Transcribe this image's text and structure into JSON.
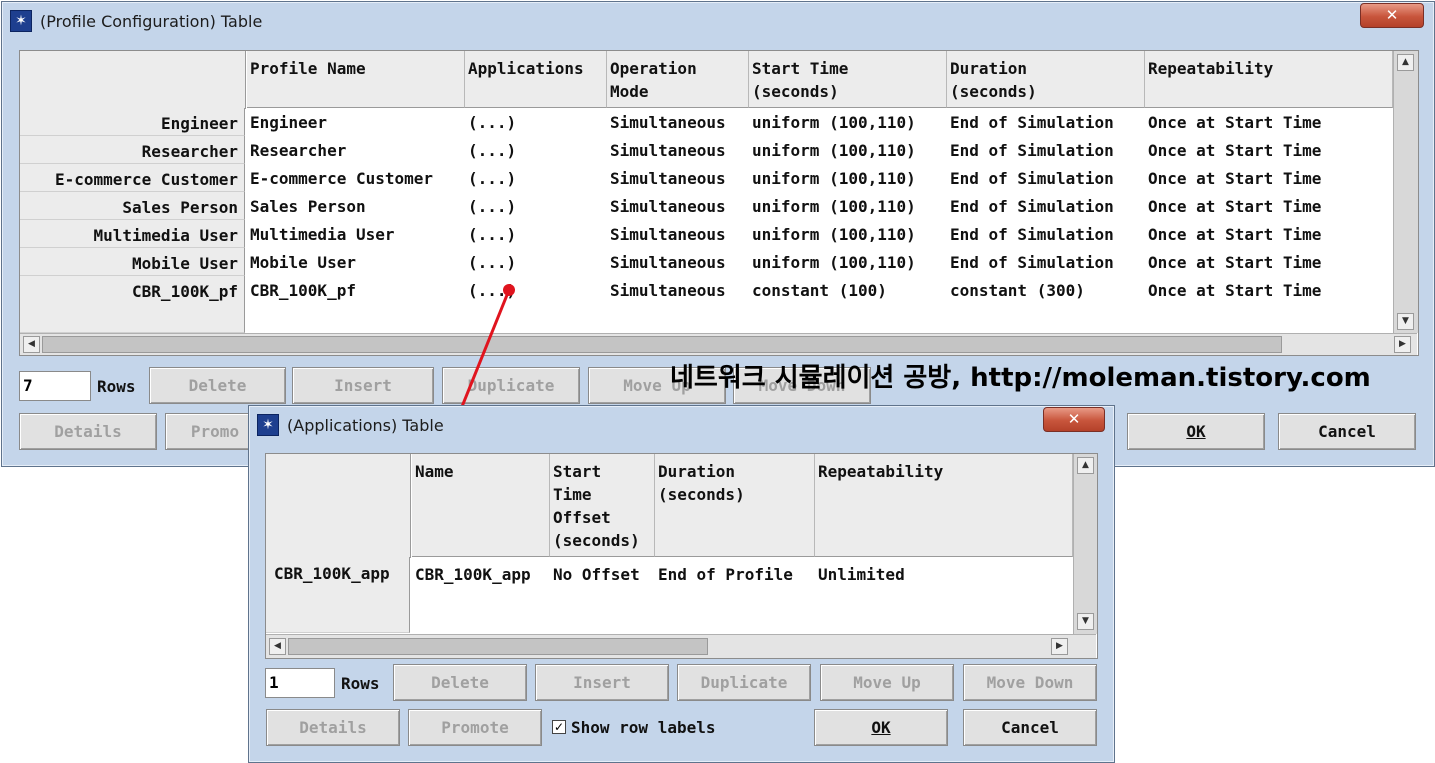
{
  "watermark": "네트워크 시뮬레이션 공방, http://moleman.tistory.com",
  "profile_window": {
    "title": "(Profile Configuration) Table",
    "close_symbol": "✕",
    "columns": [
      "Profile Name",
      "Applications",
      "Operation\nMode",
      "Start Time\n(seconds)",
      "Duration\n(seconds)",
      "Repeatability"
    ],
    "rows": [
      {
        "label": "Engineer",
        "cells": [
          "Engineer",
          "(...)",
          "Simultaneous",
          "uniform (100,110)",
          "End of Simulation",
          "Once at Start Time"
        ]
      },
      {
        "label": "Researcher",
        "cells": [
          "Researcher",
          "(...)",
          "Simultaneous",
          "uniform (100,110)",
          "End of Simulation",
          "Once at Start Time"
        ]
      },
      {
        "label": "E-commerce Customer",
        "cells": [
          "E-commerce Customer",
          "(...)",
          "Simultaneous",
          "uniform (100,110)",
          "End of Simulation",
          "Once at Start Time"
        ]
      },
      {
        "label": "Sales Person",
        "cells": [
          "Sales Person",
          "(...)",
          "Simultaneous",
          "uniform (100,110)",
          "End of Simulation",
          "Once at Start Time"
        ]
      },
      {
        "label": "Multimedia User",
        "cells": [
          "Multimedia User",
          "(...)",
          "Simultaneous",
          "uniform (100,110)",
          "End of Simulation",
          "Once at Start Time"
        ]
      },
      {
        "label": "Mobile User",
        "cells": [
          "Mobile User",
          "(...)",
          "Simultaneous",
          "uniform (100,110)",
          "End of Simulation",
          "Once at Start Time"
        ]
      },
      {
        "label": "CBR_100K_pf",
        "cells": [
          "CBR_100K_pf",
          "(...)",
          "Simultaneous",
          "constant (100)",
          "constant (300)",
          "Once at Start Time"
        ]
      }
    ],
    "rows_count": "7",
    "rows_label": "Rows",
    "buttons": {
      "delete": "Delete",
      "insert": "Insert",
      "duplicate": "Duplicate",
      "move_up": "Move Up",
      "move_down": "Move Down",
      "details": "Details",
      "promote": "Promo",
      "ok": "OK",
      "cancel": "Cancel"
    }
  },
  "apps_window": {
    "title": "(Applications) Table",
    "close_symbol": "✕",
    "columns": [
      "Name",
      "Start\nTime\nOffset\n(seconds)",
      "Duration\n(seconds)",
      "Repeatability"
    ],
    "rows": [
      {
        "label": "CBR_100K_app",
        "cells": [
          "CBR_100K_app",
          "No Offset",
          "End of Profile",
          "Unlimited"
        ]
      }
    ],
    "rows_count": "1",
    "rows_label": "Rows",
    "show_row_labels": "Show row labels",
    "show_row_labels_checked": true,
    "buttons": {
      "delete": "Delete",
      "insert": "Insert",
      "duplicate": "Duplicate",
      "move_up": "Move Up",
      "move_down": "Move Down",
      "details": "Details",
      "promote": "Promote",
      "ok": "OK",
      "cancel": "Cancel"
    }
  },
  "arrow_color": "#e0141e"
}
